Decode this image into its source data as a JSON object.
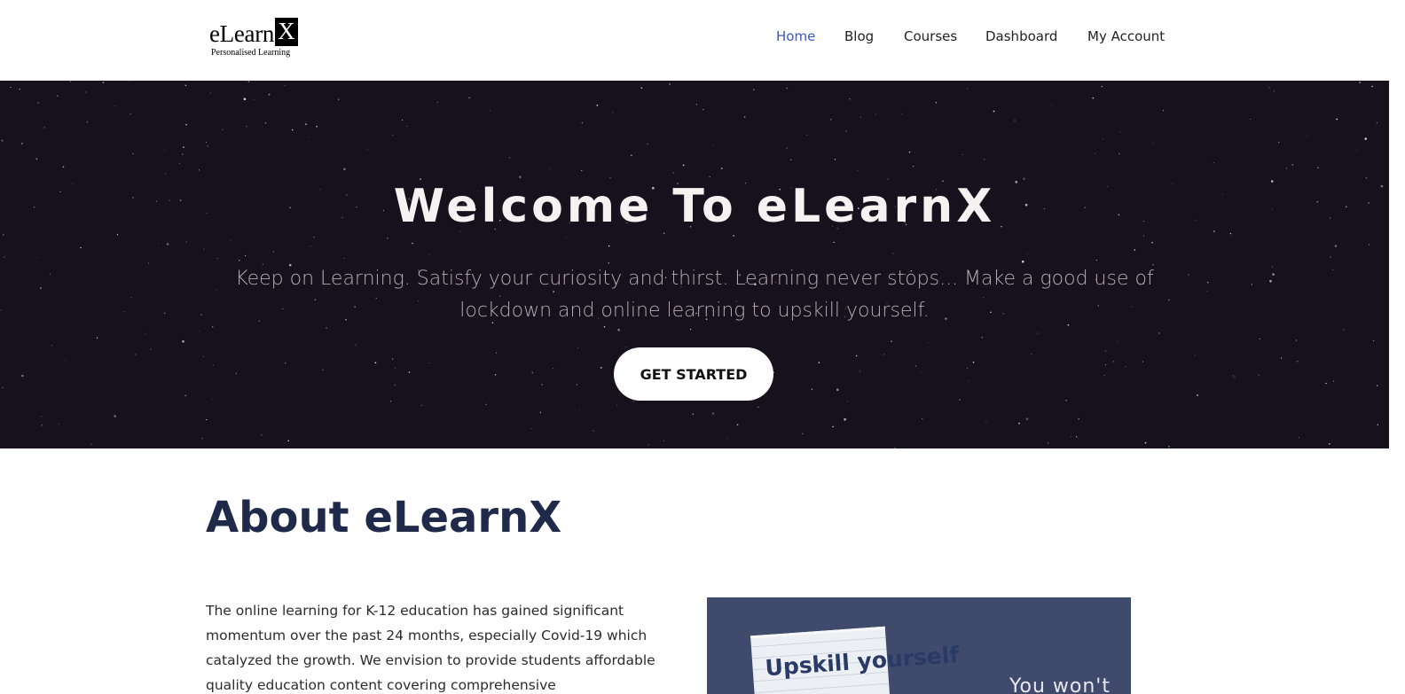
{
  "logo": {
    "wordmark": "eLearn",
    "wordmark_x": "X",
    "tagline": "Personalised Learning"
  },
  "nav": {
    "items": [
      {
        "label": "Home",
        "active": true
      },
      {
        "label": "Blog",
        "active": false
      },
      {
        "label": "Courses",
        "active": false
      },
      {
        "label": "Dashboard",
        "active": false
      },
      {
        "label": "My Account",
        "active": false
      }
    ]
  },
  "hero": {
    "title": "Welcome To eLearnX",
    "subtitle": "Keep on Learning. Satisfy your curiosity and thirst. Learning never stops... Make a good use of lockdown and online learning to upskill yourself.",
    "cta_label": "GET STARTED"
  },
  "about": {
    "title": "About eLearnX",
    "body": "The online learning for K-12 education has gained significant momentum over the past 24 months, especially Covid-19 which catalyzed the growth. We envision to provide  students affordable quality education content covering comprehensive",
    "image": {
      "note_text": "Upskill yourself",
      "side_text": "You won't"
    }
  },
  "colors": {
    "nav_active": "#3a56c9",
    "hero_bg": "#16111d",
    "about_title": "#1f2a4a",
    "image_bg": "#3f4a6c"
  }
}
